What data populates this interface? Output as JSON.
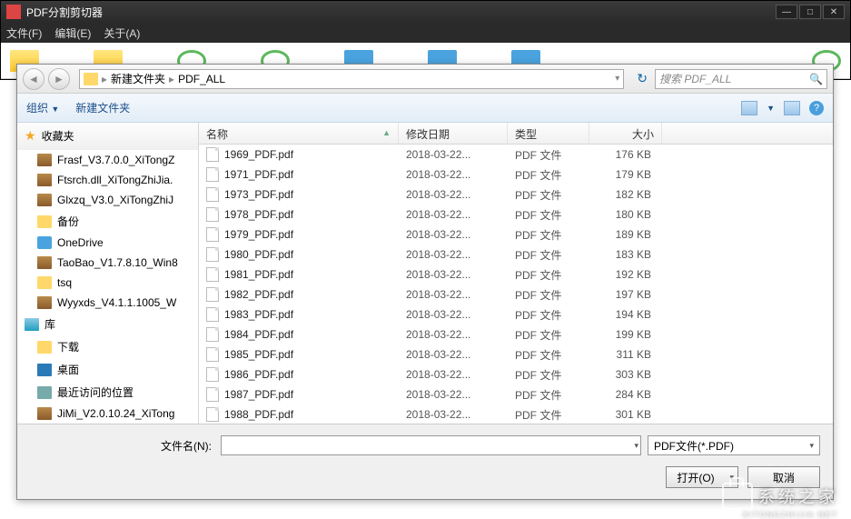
{
  "app": {
    "title": "PDF分割剪切器",
    "menus": [
      "文件(F)",
      "编辑(E)",
      "关于(A)"
    ]
  },
  "dialog": {
    "breadcrumb": {
      "parts": [
        "新建文件夹",
        "PDF_ALL"
      ]
    },
    "search_placeholder": "搜索 PDF_ALL",
    "toolbar": {
      "organize": "组织",
      "newfolder": "新建文件夹"
    },
    "sidebar": {
      "favorites_label": "收藏夹",
      "items": [
        {
          "icon": "rar",
          "label": "Frasf_V3.7.0.0_XiTongZ"
        },
        {
          "icon": "rar",
          "label": "Ftsrch.dll_XiTongZhiJia."
        },
        {
          "icon": "rar",
          "label": "Glxzq_V3.0_XiTongZhiJ"
        },
        {
          "icon": "folder",
          "label": "备份"
        },
        {
          "icon": "drive",
          "label": "OneDrive"
        },
        {
          "icon": "rar",
          "label": "TaoBao_V1.7.8.10_Win8"
        },
        {
          "icon": "folder",
          "label": "tsq"
        },
        {
          "icon": "rar",
          "label": "Wyyxds_V4.1.1.1005_W"
        }
      ],
      "groups": [
        {
          "icon": "lib",
          "label": "库"
        },
        {
          "icon": "folder",
          "label": "下载"
        },
        {
          "icon": "desk",
          "label": "桌面"
        },
        {
          "icon": "recent",
          "label": "最近访问的位置"
        },
        {
          "icon": "rar",
          "label": "JiMi_V2.0.10.24_XiTong"
        }
      ]
    },
    "columns": {
      "name": "名称",
      "date": "修改日期",
      "type": "类型",
      "size": "大小"
    },
    "type_value": "PDF 文件",
    "date_value": "2018-03-22...",
    "files": [
      {
        "name": "1969_PDF.pdf",
        "size": "176 KB"
      },
      {
        "name": "1971_PDF.pdf",
        "size": "179 KB"
      },
      {
        "name": "1973_PDF.pdf",
        "size": "182 KB"
      },
      {
        "name": "1978_PDF.pdf",
        "size": "180 KB"
      },
      {
        "name": "1979_PDF.pdf",
        "size": "189 KB"
      },
      {
        "name": "1980_PDF.pdf",
        "size": "183 KB"
      },
      {
        "name": "1981_PDF.pdf",
        "size": "192 KB"
      },
      {
        "name": "1982_PDF.pdf",
        "size": "197 KB"
      },
      {
        "name": "1983_PDF.pdf",
        "size": "194 KB"
      },
      {
        "name": "1984_PDF.pdf",
        "size": "199 KB"
      },
      {
        "name": "1985_PDF.pdf",
        "size": "311 KB"
      },
      {
        "name": "1986_PDF.pdf",
        "size": "303 KB"
      },
      {
        "name": "1987_PDF.pdf",
        "size": "284 KB"
      },
      {
        "name": "1988_PDF.pdf",
        "size": "301 KB"
      }
    ],
    "footer": {
      "filename_label": "文件名(N):",
      "filter_label": "PDF文件(*.PDF)",
      "open_label": "打开(O)",
      "cancel_label": "取消"
    }
  },
  "watermark": {
    "text": "系统之家",
    "sub": "XITONGZHIJIA.NET"
  }
}
